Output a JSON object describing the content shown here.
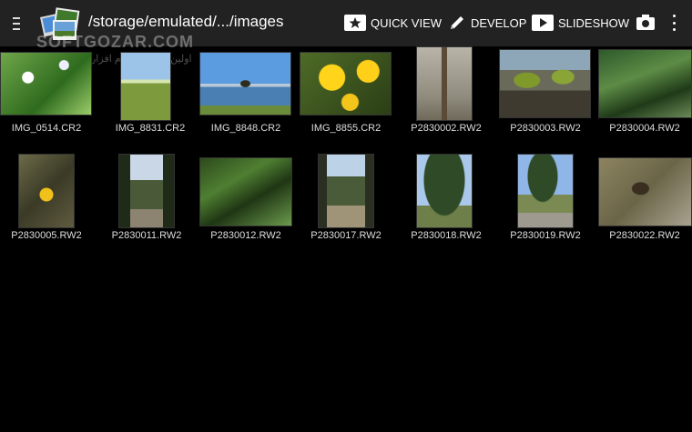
{
  "toolbar": {
    "path": "/storage/emulated/.../images",
    "quick_view_label": "QUICK VIEW",
    "develop_label": "DEVELOP",
    "slideshow_label": "SLIDESHOW"
  },
  "watermark": {
    "text": "SOFTGOZAR.COM",
    "subtext": "اولین دانشنامه نرم افزار"
  },
  "images": [
    {
      "name": "IMG_0514.CR2",
      "style": "t-flowers"
    },
    {
      "name": "IMG_8831.CR2",
      "style": "t-field"
    },
    {
      "name": "IMG_8848.CR2",
      "style": "t-lake"
    },
    {
      "name": "IMG_8855.CR2",
      "style": "t-dandelion"
    },
    {
      "name": "P2830002.RW2",
      "style": "t-twig"
    },
    {
      "name": "P2830003.RW2",
      "style": "t-moss"
    },
    {
      "name": "P2830004.RW2",
      "style": "t-pine"
    },
    {
      "name": "P2830005.RW2",
      "style": "t-yellow-ground"
    },
    {
      "name": "P2830011.RW2",
      "style": "t-forest-path"
    },
    {
      "name": "P2830012.RW2",
      "style": "t-branch"
    },
    {
      "name": "P2830017.RW2",
      "style": "t-tall-trees"
    },
    {
      "name": "P2830018.RW2",
      "style": "t-single-pine"
    },
    {
      "name": "P2830019.RW2",
      "style": "t-road-tree"
    },
    {
      "name": "P2830022.RW2",
      "style": "t-pinecone"
    }
  ],
  "colors": {
    "toolbar_bg": "#222222",
    "background": "#000000",
    "label_text": "#dddddd"
  },
  "icons": [
    "menu-icon",
    "app-logo",
    "star-icon",
    "pencil-icon",
    "play-icon",
    "camera-icon",
    "more-vert-icon"
  ]
}
